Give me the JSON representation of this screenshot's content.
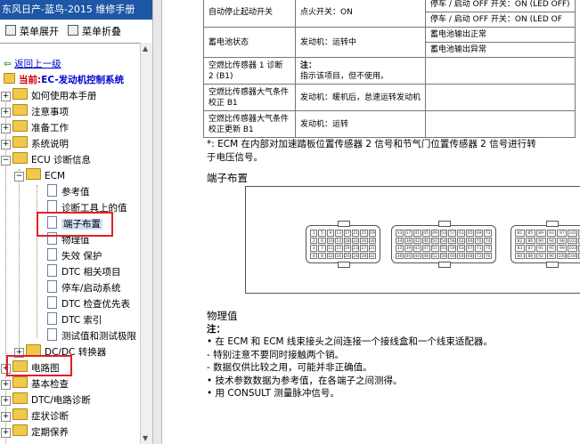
{
  "window": {
    "title": "东风日产-蓝鸟-2015 维修手册"
  },
  "toolbar": {
    "expand_label": "菜单展开",
    "collapse_label": "菜单折叠"
  },
  "nav": {
    "back_label": "返回上一级",
    "current_prefix": "当前:",
    "current_label": "EC-发动机控制系统"
  },
  "tree": {
    "items": [
      {
        "label": "如何使用本手册",
        "toggle": "+"
      },
      {
        "label": "注意事项",
        "toggle": "+"
      },
      {
        "label": "准备工作",
        "toggle": "+"
      },
      {
        "label": "系统说明",
        "toggle": "+"
      },
      {
        "label": "ECU 诊断信息",
        "toggle": "−"
      },
      {
        "label": "ECM",
        "toggle": "−"
      },
      {
        "label": "参考值"
      },
      {
        "label": "诊断工具上的值"
      },
      {
        "label": "端子布置"
      },
      {
        "label": "物理值"
      },
      {
        "label": "失效 保护"
      },
      {
        "label": "DTC 相关项目"
      },
      {
        "label": "停车/启动系统"
      },
      {
        "label": "DTC 检查优先表"
      },
      {
        "label": "DTC 索引"
      },
      {
        "label": "测试值和测试极限"
      },
      {
        "label": "DC/DC 转换器",
        "toggle": "+"
      },
      {
        "label": "电路图",
        "toggle": "+"
      },
      {
        "label": "基本检查",
        "toggle": "+"
      },
      {
        "label": "DTC/电路诊断",
        "toggle": "+"
      },
      {
        "label": "症状诊断",
        "toggle": "+"
      },
      {
        "label": "定期保养",
        "toggle": "+"
      }
    ]
  },
  "spec_table": {
    "rows": [
      {
        "item": "自动停止起动开关",
        "cond": "点火开关：ON",
        "val": "停车 / 启动 OFF 开关：ON (LED OFF)"
      },
      {
        "item": "",
        "cond": "",
        "val": "停车 / 启动 OFF 开关：ON (LED OF"
      },
      {
        "item": "蓄电池状态",
        "cond": "发动机：运转中",
        "val": "蓄电池输出正常"
      },
      {
        "item": "",
        "cond": "",
        "val": "蓄电池输出异常"
      },
      {
        "item": "空燃比传感器 1 诊断 2 (B1)",
        "cond_title": "注：",
        "cond": "指示该项目，但不使用。",
        "val": ""
      },
      {
        "item": "空燃比传感器大气条件校正 B1",
        "cond": "发动机：暖机后，怠速运转发动机",
        "val": ""
      },
      {
        "item": "空燃比传感器大气条件校正更新 B1",
        "cond": "发动机：运转",
        "val": ""
      }
    ]
  },
  "note": {
    "line1": "*: ECM 在内部对加速踏板位置传感器 2 信号和节气门位置传感器 2 信号进行转",
    "line2": "于电压信号。"
  },
  "terminal": {
    "title": "端子布置"
  },
  "connectors": [
    {
      "pins": [
        "1",
        "5",
        "9",
        "13",
        "17",
        "21",
        "25",
        "29",
        "2",
        "6",
        "10",
        "14",
        "18",
        "22",
        "26",
        "30",
        "3",
        "7",
        "11",
        "15",
        "19",
        "23",
        "27",
        "31",
        "4",
        "8",
        "12",
        "16",
        "20",
        "24",
        "28",
        "32"
      ]
    },
    {
      "pins": [
        "33",
        "37",
        "41",
        "45",
        "49",
        "53",
        "57",
        "61",
        "65",
        "69",
        "73",
        "34",
        "38",
        "42",
        "46",
        "50",
        "54",
        "58",
        "62",
        "66",
        "70",
        "74",
        "35",
        "39",
        "43",
        "47",
        "51",
        "55",
        "59",
        "63",
        "67",
        "71",
        "75",
        "36",
        "40",
        "44",
        "48",
        "52",
        "56",
        "60",
        "64",
        "68",
        "72",
        "76"
      ]
    },
    {
      "pins": [
        "81",
        "85",
        "89",
        "93",
        "97",
        "101",
        "105",
        "82",
        "86",
        "90",
        "94",
        "98",
        "102",
        "106",
        "83",
        "87",
        "91",
        "95",
        "99",
        "103",
        "107",
        "84",
        "88",
        "92",
        "96",
        "100",
        "104",
        "108"
      ]
    }
  ],
  "physical": {
    "title": "物理值",
    "note_label": "注："
  },
  "bullets": [
    "• 在 ECM 和 ECM 线束接头之间连接一个接线盒和一个线束适配器。",
    "- 特别注意不要同时接触两个销。",
    "- 数据仅供比较之用，可能并非正确值。",
    "• 技术参数数据为参考值，在各端子之间测得。",
    "• 用 CONSULT 测量脉冲信号。"
  ],
  "highlight_color": "#e0202a",
  "title_bar_color": "#1d57a6"
}
